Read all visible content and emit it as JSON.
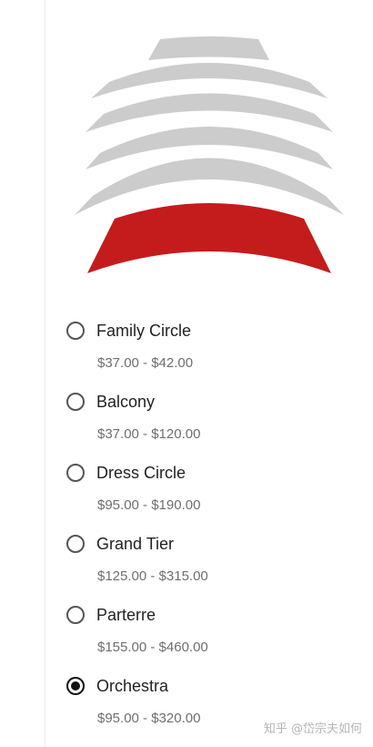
{
  "colors": {
    "section_inactive": "#cccccc",
    "section_active": "#c41c1c",
    "text_primary": "#222222",
    "text_secondary": "#6e6e6e"
  },
  "sections": [
    {
      "name": "Family Circle",
      "price": "$37.00 - $42.00",
      "selected": false
    },
    {
      "name": "Balcony",
      "price": "$37.00 - $120.00",
      "selected": false
    },
    {
      "name": "Dress Circle",
      "price": "$95.00 - $190.00",
      "selected": false
    },
    {
      "name": "Grand Tier",
      "price": "$125.00 - $315.00",
      "selected": false
    },
    {
      "name": "Parterre",
      "price": "$155.00 - $460.00",
      "selected": false
    },
    {
      "name": "Orchestra",
      "price": "$95.00 - $320.00",
      "selected": true
    }
  ],
  "watermark": "知乎 @岱宗夫如何"
}
